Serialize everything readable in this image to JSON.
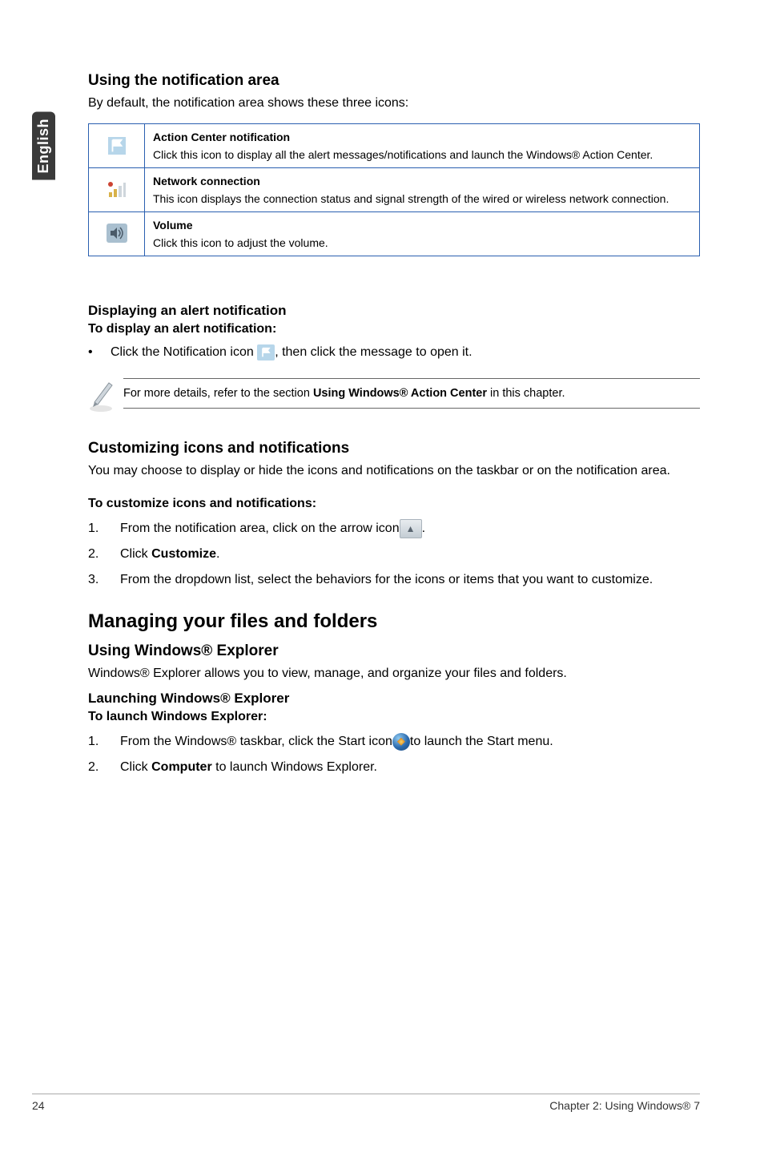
{
  "side_tab": "English",
  "section1": {
    "heading": "Using the notification area",
    "intro": "By default, the notification area shows these three icons:",
    "rows": [
      {
        "title": "Action Center notification",
        "desc": "Click this icon to display all the alert messages/notifications and launch the Windows® Action Center."
      },
      {
        "title": "Network connection",
        "desc": "This icon displays the connection status and signal strength of the wired or wireless network connection."
      },
      {
        "title": "Volume",
        "desc": "Click this icon to adjust the volume."
      }
    ]
  },
  "alert": {
    "heading": "Displaying an alert notification",
    "sub": "To display an alert notification:",
    "line_pre": "Click the Notification icon ",
    "line_post": ", then click the message to open it."
  },
  "note": {
    "pre": "For more details, refer to the section ",
    "bold": "Using Windows® Action Center",
    "post": " in this chapter."
  },
  "customize": {
    "heading": "Customizing icons and notifications",
    "intro": "You may choose to display or hide the icons and notifications on the taskbar or on the notification area.",
    "sub": "To customize icons and notifications:",
    "step1_pre": "From the notification area, click on the arrow icon ",
    "step1_post": ".",
    "step2_pre": "Click ",
    "step2_bold": "Customize",
    "step2_post": ".",
    "step3": "From the dropdown list, select the behaviors for the icons or items that you want to customize."
  },
  "managing": {
    "heading": "Managing your files and folders",
    "sub1": "Using Windows® Explorer",
    "intro1": "Windows® Explorer allows you to view, manage, and organize your files and folders.",
    "sub2": "Launching Windows® Explorer",
    "sub3": "To launch Windows Explorer:",
    "step1_pre": "From the Windows® taskbar, click the Start icon ",
    "step1_post": " to launch the Start menu.",
    "step2_pre": "Click ",
    "step2_bold": "Computer",
    "step2_post": " to launch Windows Explorer."
  },
  "footer": {
    "pagenum": "24",
    "chapter": "Chapter 2: Using Windows® 7"
  },
  "icons": {
    "flag": "action-center-flag-icon",
    "network": "network-signal-icon",
    "volume": "volume-speaker-icon",
    "pencil": "pencil-note-icon",
    "arrow": "show-hidden-arrow-icon",
    "start": "start-orb-icon"
  }
}
